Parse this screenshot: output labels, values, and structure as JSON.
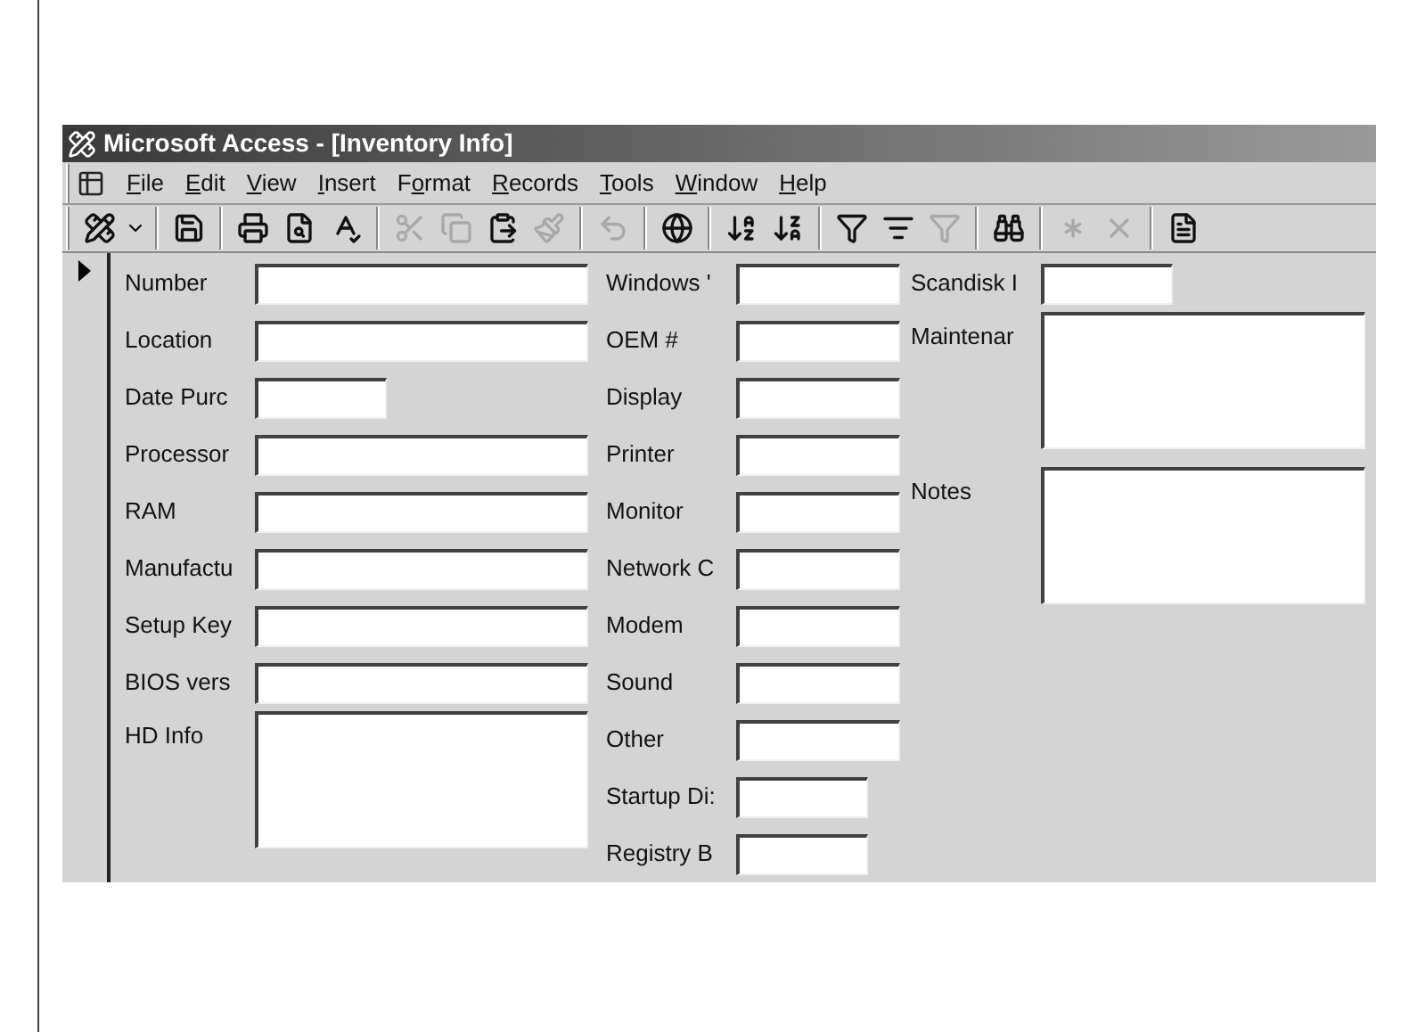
{
  "window": {
    "title": "Microsoft Access - [Inventory Info]"
  },
  "menu": [
    {
      "key": "F",
      "post": "ile"
    },
    {
      "key": "E",
      "post": "dit"
    },
    {
      "key": "V",
      "post": "iew"
    },
    {
      "key": "I",
      "post": "nsert"
    },
    {
      "pre": "F",
      "key": "o",
      "post": "rmat"
    },
    {
      "key": "R",
      "post": "ecords"
    },
    {
      "key": "T",
      "post": "ools"
    },
    {
      "key": "W",
      "post": "indow"
    },
    {
      "key": "H",
      "post": "elp"
    }
  ],
  "toolbar": [
    {
      "buttons": [
        {
          "kind": "design",
          "disabled": false
        },
        {
          "kind": "dropdown",
          "disabled": false
        }
      ]
    },
    {
      "buttons": [
        {
          "kind": "save",
          "disabled": false
        }
      ]
    },
    {
      "buttons": [
        {
          "kind": "print",
          "disabled": false
        },
        {
          "kind": "preview",
          "disabled": false
        },
        {
          "kind": "spelling",
          "disabled": false
        }
      ]
    },
    {
      "buttons": [
        {
          "kind": "cut",
          "disabled": true
        },
        {
          "kind": "copy",
          "disabled": true
        },
        {
          "kind": "paste",
          "disabled": false
        },
        {
          "kind": "painter",
          "disabled": true
        }
      ]
    },
    {
      "buttons": [
        {
          "kind": "undo",
          "disabled": true
        }
      ]
    },
    {
      "buttons": [
        {
          "kind": "web",
          "disabled": false
        }
      ]
    },
    {
      "buttons": [
        {
          "kind": "sort_asc",
          "disabled": false
        },
        {
          "kind": "sort_desc",
          "disabled": false
        }
      ]
    },
    {
      "buttons": [
        {
          "kind": "filter_selection",
          "disabled": false
        },
        {
          "kind": "filter_form",
          "disabled": false
        },
        {
          "kind": "apply_filter",
          "disabled": true
        }
      ]
    },
    {
      "buttons": [
        {
          "kind": "find",
          "disabled": false
        }
      ]
    },
    {
      "buttons": [
        {
          "kind": "new_record",
          "disabled": true
        },
        {
          "kind": "delete_record",
          "disabled": true
        }
      ]
    },
    {
      "buttons": [
        {
          "kind": "properties",
          "disabled": false
        }
      ]
    }
  ],
  "form": {
    "columns": [
      {
        "fields": [
          {
            "label": "Number",
            "kind": "text"
          },
          {
            "label": "Location",
            "kind": "text"
          },
          {
            "label": "Date Purc",
            "kind": "short"
          },
          {
            "label": "Processor",
            "kind": "text"
          },
          {
            "label": "RAM",
            "kind": "text"
          },
          {
            "label": "Manufactu",
            "kind": "text"
          },
          {
            "label": "Setup Key",
            "kind": "text"
          },
          {
            "label": "BIOS vers",
            "kind": "text"
          },
          {
            "label": "HD Info",
            "kind": "memo"
          }
        ]
      },
      {
        "fields": [
          {
            "label": "Windows '",
            "kind": "text"
          },
          {
            "label": "OEM #",
            "kind": "text"
          },
          {
            "label": "Display",
            "kind": "text"
          },
          {
            "label": "Printer",
            "kind": "text"
          },
          {
            "label": "Monitor",
            "kind": "text"
          },
          {
            "label": "Network C",
            "kind": "text"
          },
          {
            "label": "Modem",
            "kind": "text"
          },
          {
            "label": "Sound",
            "kind": "text"
          },
          {
            "label": "Other",
            "kind": "text"
          },
          {
            "label": "Startup Di:",
            "kind": "short"
          },
          {
            "label": "Registry B",
            "kind": "short"
          }
        ]
      },
      {
        "fields": [
          {
            "label": "Scandisk I",
            "kind": "short"
          },
          {
            "label": "Maintenar",
            "kind": "memo"
          },
          {
            "label": "Notes",
            "kind": "memo"
          }
        ]
      }
    ]
  }
}
